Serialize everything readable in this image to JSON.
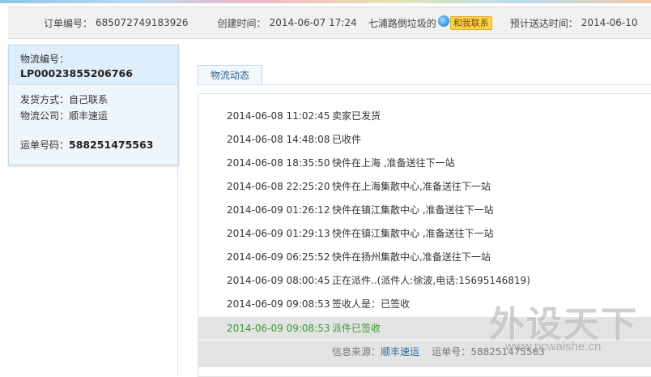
{
  "order": {
    "order_no_label": "订单编号：",
    "order_no": "685072749183926",
    "created_label": "创建时间：",
    "created": "2014-06-07 17:24",
    "seller": "七浦路倒垃圾的",
    "contact_label": "和我联系",
    "eta_label": "预计送达时间：",
    "eta": "2014-06-10"
  },
  "sidebar": {
    "logistics_no_label": "物流编号：",
    "logistics_no": "LP00023855206766",
    "ship_method": "发货方式：自己联系",
    "company": "物流公司：顺丰速运",
    "waybill_label": "运单号码：",
    "waybill": "588251475563"
  },
  "tab": {
    "label": "物流动态"
  },
  "tracking": [
    {
      "time": "2014-06-08 11:02:45",
      "msg": "卖家已发货"
    },
    {
      "time": "2014-06-08 14:48:08",
      "msg": "已收件"
    },
    {
      "time": "2014-06-08 18:35:50",
      "msg": "快件在上海 ,准备送往下一站"
    },
    {
      "time": "2014-06-08 22:25:20",
      "msg": "快件在上海集散中心,准备送往下一站"
    },
    {
      "time": "2014-06-09 01:26:12",
      "msg": "快件在镇江集散中心 ,准备送往下一站"
    },
    {
      "time": "2014-06-09 01:29:13",
      "msg": "快件在镇江集散中心 ,准备送往下一站"
    },
    {
      "time": "2014-06-09 06:25:52",
      "msg": "快件在扬州集散中心,准备送往下一站"
    },
    {
      "time": "2014-06-09 08:00:45",
      "msg": "正在派件..(派件人:徐波,电话:15695146819)"
    },
    {
      "time": "2014-06-09 09:08:53",
      "msg": "签收人是：已签收"
    },
    {
      "time": "2014-06-09 09:08:53",
      "msg": "派件已签收"
    }
  ],
  "source": {
    "label": "信息来源：",
    "company": "顺丰速运",
    "waybill_label": "运单号：",
    "waybill": "588251475563"
  },
  "watermark": {
    "title": "外设天下",
    "url": "www.pcwaishe.cn"
  },
  "colors": {
    "highlight_text": "#3a9a37",
    "link": "#2a6aa6",
    "sidebar_bg": "#eef5fb"
  }
}
